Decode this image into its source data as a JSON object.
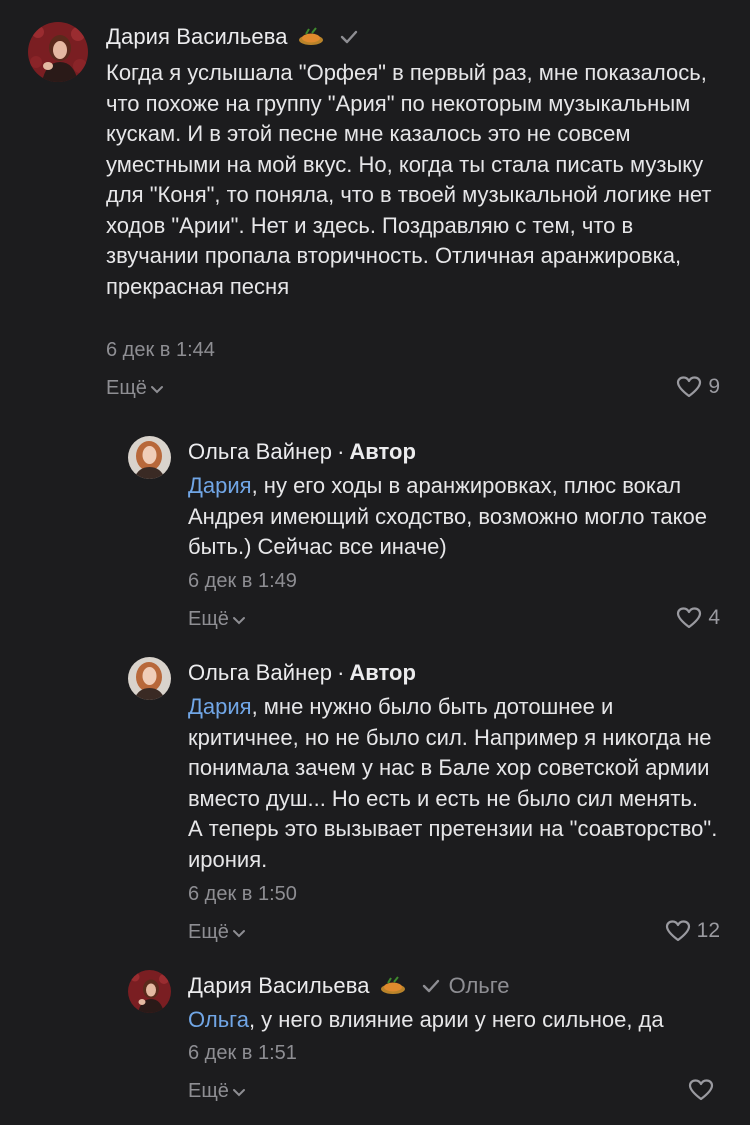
{
  "colors": {
    "background": "#1c1c1e",
    "text": "#e6e6e8",
    "muted": "#8e8e93",
    "mention": "#71a6e6"
  },
  "comments": [
    {
      "author": "Дария Васильева",
      "avatar": "avatar-daria",
      "emoji": "dish-emoji",
      "verified": true,
      "text": "Когда я услышала \"Орфея\" в первый раз, мне показалось, что похоже на группу \"Ария\" по некоторым музыкальным кускам. И в этой песне мне казалось это не совсем уместными на мой вкус. Но, когда ты стала писать музыку для \"Коня\", то поняла, что в твоей музыкальной логике нет ходов \"Арии\". Нет и здесь. Поздравляю с тем, что в звучании пропала вторичность. Отличная аранжировка, прекрасная песня",
      "time": "6 дек в 1:44",
      "more": "Ещё",
      "likes": "9"
    },
    {
      "author": "Ольга Вайнер",
      "separator": "·",
      "role": "Автор",
      "avatar": "avatar-olga",
      "mention": "Дария",
      "text": ", ну его ходы в аранжировках, плюс вокал Андрея имеющий сходство, возможно могло такое быть.) Сейчас все иначе)",
      "time": "6 дек в 1:49",
      "more": "Ещё",
      "likes": "4"
    },
    {
      "author": "Ольга Вайнер",
      "separator": "·",
      "role": "Автор",
      "avatar": "avatar-olga",
      "mention": "Дария",
      "text": ", мне нужно было быть дотошнее и критичнее, но не было сил. Например я никогда не понимала зачем у нас в Бале хор советской армии вместо душ... Но есть и есть не было сил менять. А теперь это вызывает претензии на \"соавторство\". ирония.",
      "time": "6 дек в 1:50",
      "more": "Ещё",
      "likes": "12"
    },
    {
      "author": "Дария Васильева",
      "avatar": "avatar-daria",
      "emoji": "dish-emoji",
      "verified": true,
      "reply_to": "Ольге",
      "mention": "Ольга",
      "text": ", у него влияние арии у него сильное, да",
      "time": "6 дек в 1:51",
      "more": "Ещё",
      "likes": ""
    }
  ]
}
